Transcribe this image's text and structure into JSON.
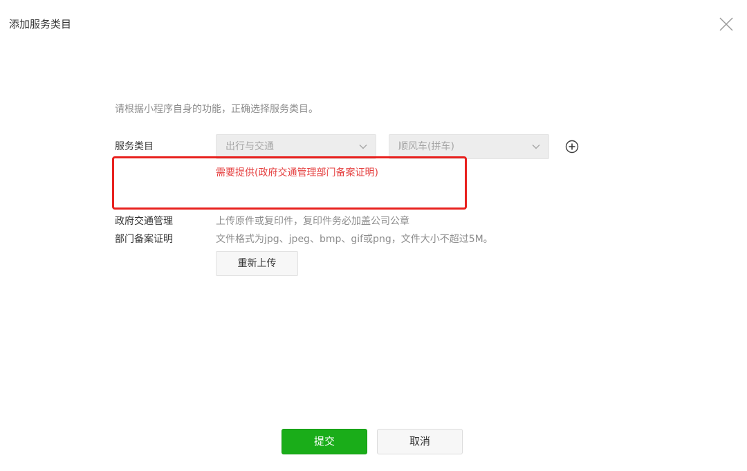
{
  "dialog": {
    "title": "添加服务类目"
  },
  "form": {
    "tip": "请根据小程序自身的功能，正确选择服务类目。",
    "category_label": "服务类目",
    "category_primary": "出行与交通",
    "category_secondary": "顺风车(拼车)",
    "requirement": "需要提供(政府交通管理部门备案证明)",
    "document_label_line1": "政府交通管理",
    "document_label_line2": "部门备案证明",
    "upload_hint_line1": "上传原件或复印件，复印件务必加盖公司公章",
    "upload_hint_line2": "文件格式为jpg、jpeg、bmp、gif或png，文件大小不超过5M。",
    "reupload_label": "重新上传"
  },
  "footer": {
    "submit_label": "提交",
    "cancel_label": "取消"
  },
  "icons": {
    "close": "close-icon",
    "dropdown": "chevron-down-icon",
    "add": "plus-circle-icon"
  },
  "colors": {
    "primary_green": "#1aad19",
    "warning_red": "#e54141",
    "highlight_border": "#e8211e",
    "muted_text": "#8d8d8d"
  }
}
